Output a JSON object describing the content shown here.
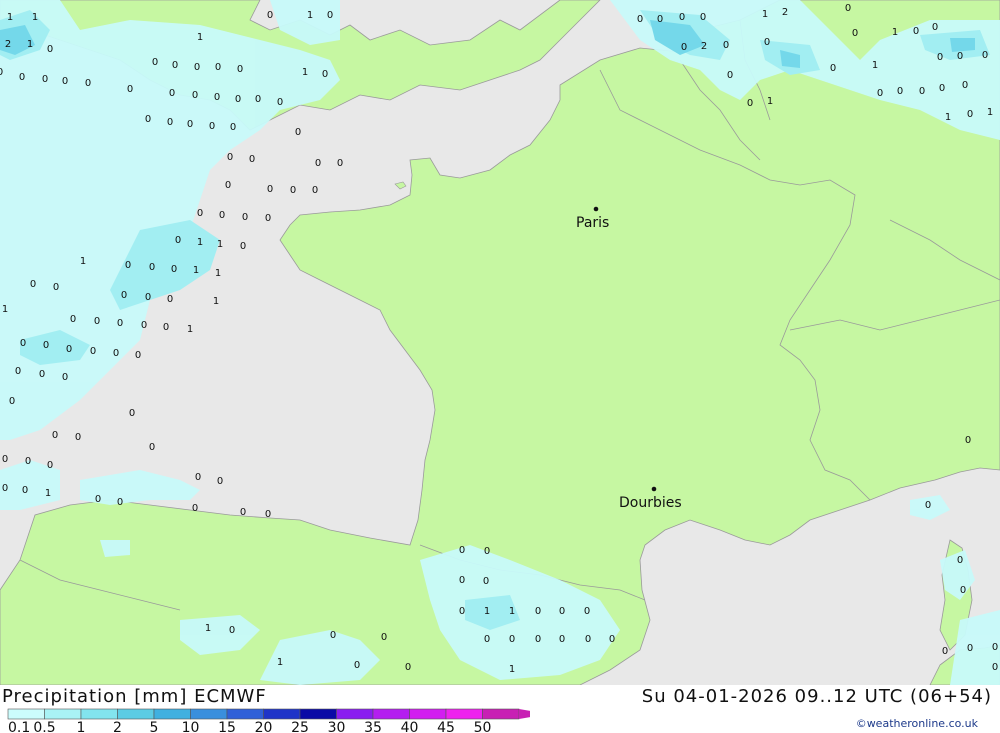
{
  "header": {
    "title": "Precipitation [mm] ECMWF",
    "valid_time": "Su 04-01-2026 09..12 UTC (06+54)"
  },
  "legend": {
    "ticks": [
      "0.1",
      "0.5",
      "1",
      "2",
      "5",
      "10",
      "15",
      "20",
      "25",
      "30",
      "35",
      "40",
      "45",
      "50"
    ],
    "colors": [
      "#ccfcfc",
      "#a9f3f5",
      "#82e4ee",
      "#5ccce4",
      "#40b0e0",
      "#3a8fdd",
      "#3060d8",
      "#1f34c8",
      "#0a0aa6",
      "#8a1df0",
      "#b41ef0",
      "#d21ef0",
      "#ee22ee",
      "#c820b4"
    ]
  },
  "credit": "©weatheronline.co.uk",
  "cities": [
    {
      "name": "Paris"
    },
    {
      "name": "Dourbies"
    }
  ],
  "colors": {
    "sea": "#e8e8e8",
    "land": "#c6f7a2",
    "border": "#9a9a9a",
    "precip_light": "#c8fafa",
    "precip_medium": "#a2eef2",
    "precip_heavy": "#74d8ea"
  },
  "precip_labels": [
    "1",
    "1",
    "0",
    "1",
    "0",
    "2",
    "1",
    "0",
    "1",
    "0",
    "0",
    "0",
    "0",
    "0",
    "0",
    "0",
    "0",
    "0",
    "0",
    "0",
    "1",
    "0",
    "0",
    "0",
    "0",
    "0",
    "0",
    "0",
    "0",
    "0",
    "0",
    "0",
    "0",
    "0",
    "0",
    "0",
    "0",
    "0",
    "0",
    "0",
    "0",
    "0",
    "0",
    "0",
    "0",
    "0",
    "0",
    "1",
    "1",
    "0",
    "0",
    "0",
    "0",
    "1",
    "1",
    "1",
    "0",
    "0",
    "0",
    "0",
    "0",
    "1",
    "1",
    "0",
    "0",
    "0",
    "0",
    "0",
    "1",
    "0",
    "0",
    "0",
    "0",
    "0",
    "0",
    "0",
    "0",
    "0",
    "0",
    "0",
    "0",
    "0",
    "0",
    "0",
    "0",
    "0",
    "0",
    "0",
    "0",
    "0",
    "1",
    "0",
    "0",
    "0",
    "0",
    "0",
    "0",
    "0",
    "0",
    "0",
    "0",
    "1",
    "1",
    "0",
    "0",
    "0",
    "0",
    "0",
    "0",
    "0",
    "0",
    "0",
    "1",
    "0",
    "0",
    "0",
    "1",
    "0",
    "0",
    "1",
    "0",
    "0",
    "0",
    "0",
    "0",
    "2",
    "0",
    "0",
    "1",
    "2",
    "0",
    "1",
    "0",
    "0",
    "0",
    "0",
    "0",
    "0",
    "0",
    "0",
    "1",
    "0",
    "0",
    "0",
    "0",
    "0",
    "0",
    "1",
    "1",
    "0",
    "1",
    "0",
    "0",
    "0",
    "0",
    "0",
    "0",
    "0",
    "0",
    "0",
    "1",
    "0",
    "0",
    "0",
    "0",
    "0",
    "0"
  ]
}
